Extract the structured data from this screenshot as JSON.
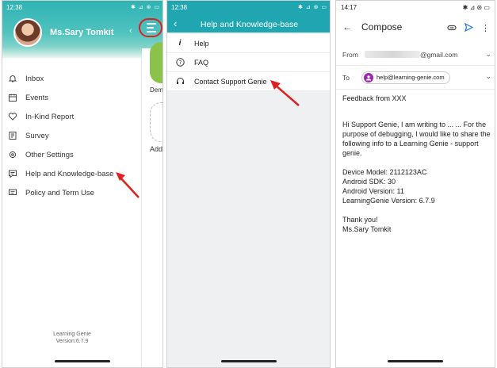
{
  "phone1": {
    "status_time": "12:38",
    "status_icons": "✱ ⊿ ⊛ ▭",
    "user_name": "Ms.Sary Tomkit",
    "menu_items": [
      {
        "label": "Inbox",
        "icon": "bell-icon"
      },
      {
        "label": "Events",
        "icon": "calendar-icon"
      },
      {
        "label": "In-Kind Report",
        "icon": "heart-icon"
      },
      {
        "label": "Survey",
        "icon": "survey-icon"
      },
      {
        "label": "Other Settings",
        "icon": "gear-icon"
      },
      {
        "label": "Help and Knowledge-base",
        "icon": "chat-icon"
      },
      {
        "label": "Policy and Term Use",
        "icon": "document-icon"
      }
    ],
    "background_labels": {
      "demo": "Dem",
      "add": "Add"
    },
    "footer_app": "Learning Genie",
    "footer_version": "Version:6.7.9"
  },
  "phone2": {
    "status_time": "12:38",
    "status_icons": "✱ ⊿ ⊛ ▭",
    "title": "Help and Knowledge-base",
    "items": [
      {
        "label": "Help",
        "icon": "info-icon"
      },
      {
        "label": "FAQ",
        "icon": "question-icon"
      },
      {
        "label": "Contact Support Genie",
        "icon": "headset-icon"
      }
    ]
  },
  "phone3": {
    "status_time": "14:17",
    "status_icons": "✱ ⊿ ⊛ ▭",
    "title": "Compose",
    "from_label": "From",
    "from_value": "@gmail.com",
    "to_label": "To",
    "to_value": "help@learning-genie.com",
    "subject": "Feedback  from  XXX",
    "body_intro": "Hi Support Genie, I am writing to ... ... For the purpose of debugging, I would like to share the following info to a Learning Genie - support genie.",
    "device_model": "Device Model: 2112123AC",
    "android_sdk": "Android SDK: 30",
    "android_version": "Android Version: 11",
    "lg_version": "LearningGenie Version: 6.7.9",
    "thanks": "Thank you!",
    "signature": "Ms.Sary Tomkit"
  },
  "colors": {
    "teal_header": "#1fa6b0",
    "annotation_red": "#e02020",
    "send_blue": "#1a73e8"
  }
}
